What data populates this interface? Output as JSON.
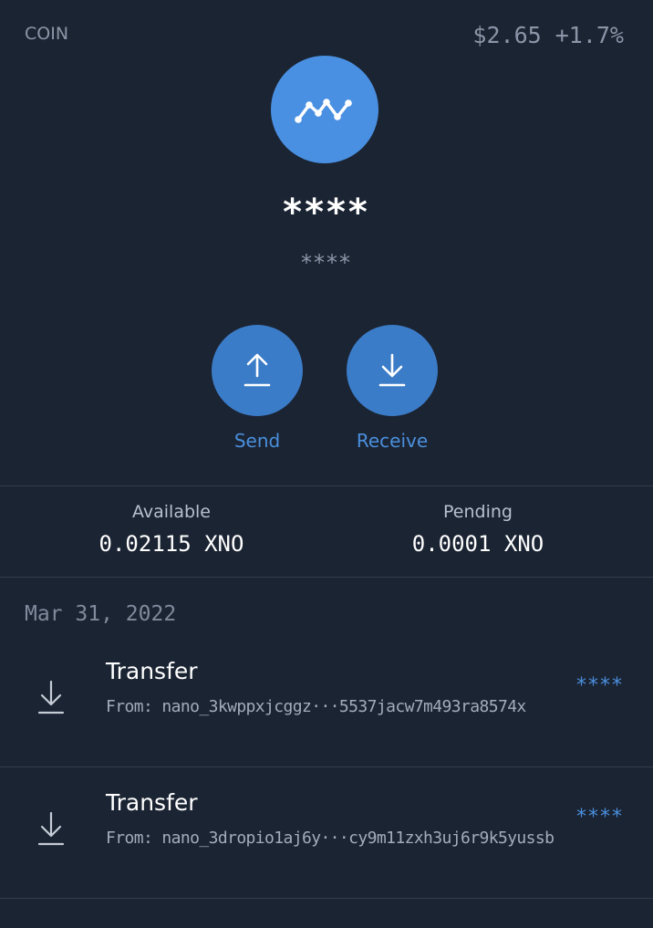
{
  "header": {
    "coin_label": "COIN",
    "price": "$2.65 +1.7%"
  },
  "balance": {
    "amount": "****",
    "fiat": "****"
  },
  "actions": {
    "send_label": "Send",
    "receive_label": "Receive"
  },
  "stats": {
    "available_label": "Available",
    "available_value": "0.02115 XNO",
    "pending_label": "Pending",
    "pending_value": "0.0001 XNO"
  },
  "history": {
    "date": "Mar 31, 2022",
    "transactions": [
      {
        "title": "Transfer",
        "from": "From: nano_3kwppxjcggz···5537jacw7m493ra8574x",
        "amount": "****",
        "icon": "download-icon"
      },
      {
        "title": "Transfer",
        "from": "From: nano_3dropio1aj6y···cy9m11zxh3uj6r9k5yussb",
        "amount": "****",
        "icon": "download-icon"
      }
    ]
  },
  "colors": {
    "background": "#1b2433",
    "accent": "#4a90e2",
    "button": "#3b7cc8",
    "muted_text": "#8a96a8"
  }
}
